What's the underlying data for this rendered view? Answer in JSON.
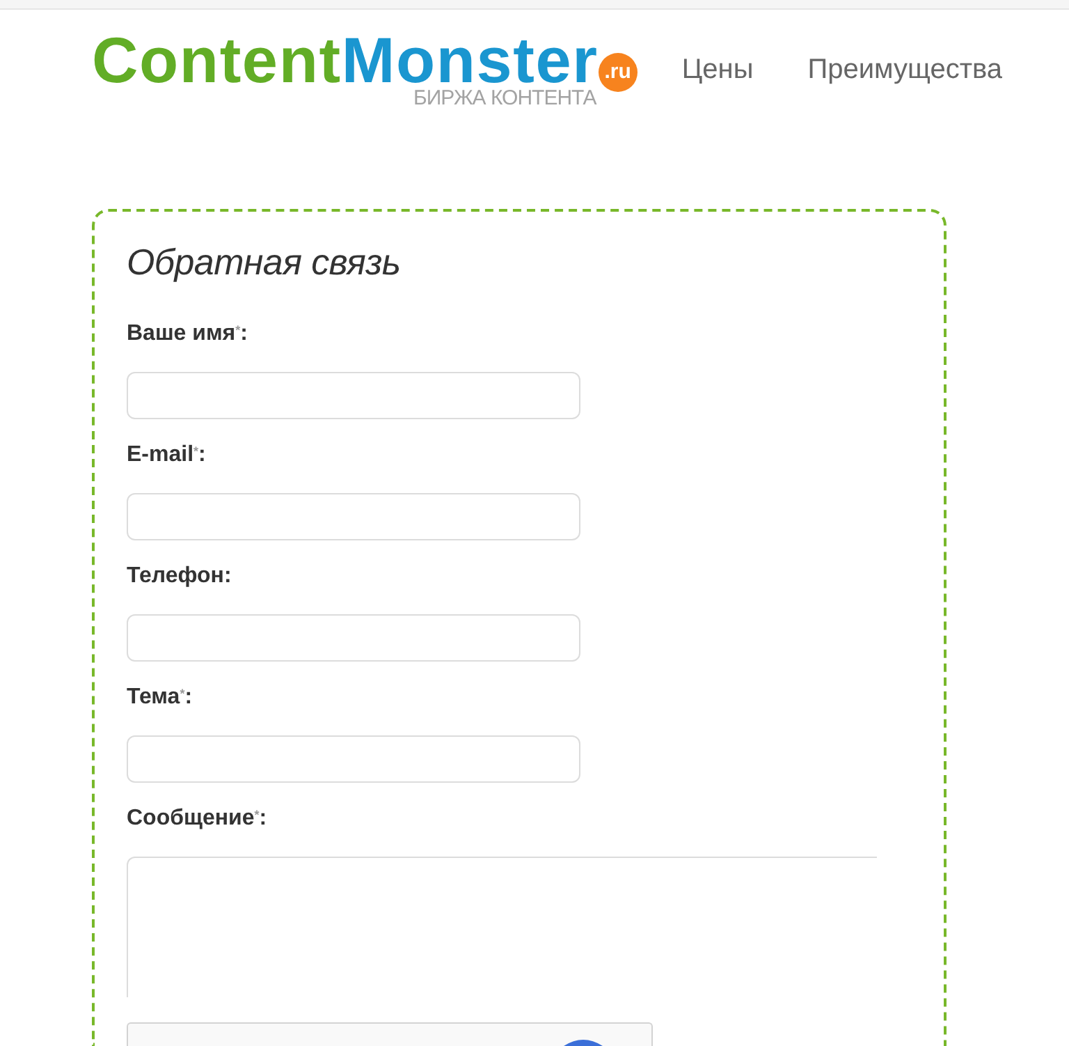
{
  "header": {
    "logo": {
      "wordmark_first": "Content",
      "wordmark_second": "Monster",
      "domain": ".ru",
      "tagline": "БИРЖА КОНТЕНТА"
    },
    "nav": [
      {
        "label": "Цены"
      },
      {
        "label": "Преимущества"
      }
    ]
  },
  "form": {
    "title": "Обратная связь",
    "fields": [
      {
        "label": "Ваше имя$^{*}$:",
        "kind": "input"
      },
      {
        "label": "E-mail$^{*}$:",
        "kind": "input"
      },
      {
        "label": "Телефон:",
        "kind": "input"
      },
      {
        "label": "Тема$^{*}$:",
        "kind": "input"
      },
      {
        "label": "Сообщение$^{*}$:",
        "kind": "textarea"
      }
    ]
  }
}
